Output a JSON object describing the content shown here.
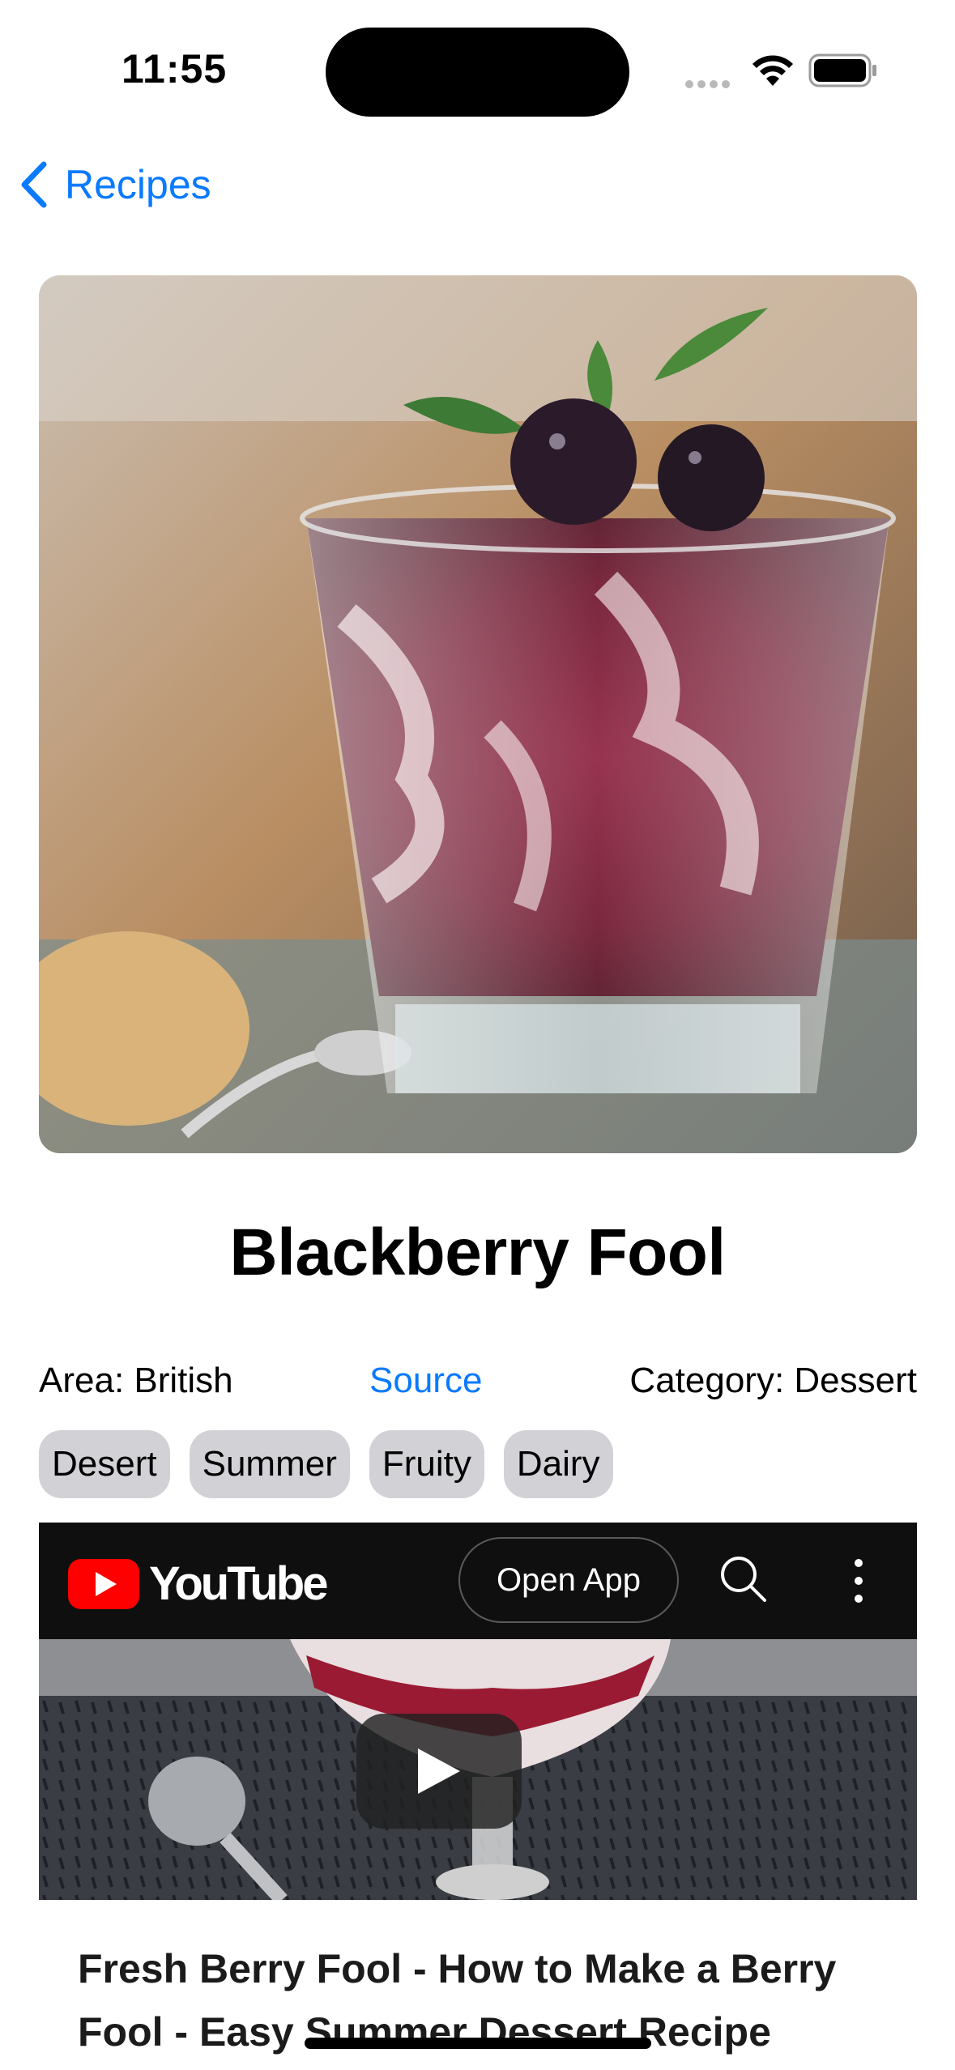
{
  "status_bar": {
    "time": "11:55"
  },
  "nav": {
    "back_label": "Recipes",
    "accent": "#0a7aff"
  },
  "recipe": {
    "title": "Blackberry Fool",
    "area": "Area: British",
    "source_label": "Source",
    "category": "Category: Dessert",
    "tags": [
      "Desert",
      "Summer",
      "Fruity",
      "Dairy"
    ]
  },
  "video": {
    "brand": "YouTube",
    "open_app_label": "Open App",
    "title": "Fresh Berry Fool - How to Make a Berry Fool - Easy Summer Dessert Recipe",
    "brand_color": "#ff0000"
  },
  "icons": [
    "chevron-left-icon",
    "wifi-icon",
    "battery-icon",
    "youtube-logo-icon",
    "search-icon",
    "more-vertical-icon",
    "play-icon"
  ]
}
